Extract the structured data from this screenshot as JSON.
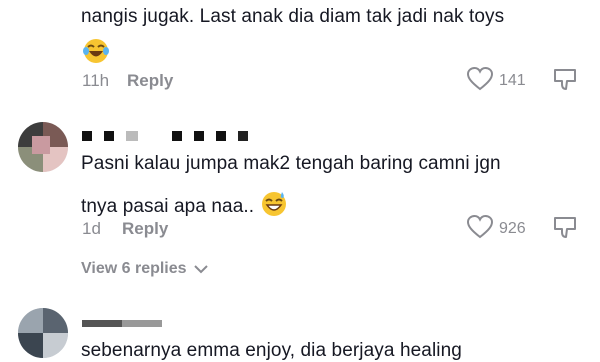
{
  "comment1": {
    "text": "nangis jugak. Last anak dia diam tak jadi nak toys",
    "time": "11h",
    "reply_label": "Reply",
    "likes": "141",
    "emoji": "laughing-tears"
  },
  "comment2": {
    "line1": "Pasni kalau jumpa mak2 tengah baring camni jgn",
    "line2": "tnya pasai apa naa..",
    "emoji": "sweat-smile",
    "time": "1d",
    "reply_label": "Reply",
    "likes": "926",
    "view_replies": "View 6 replies"
  },
  "comment3": {
    "text": "sebenarnya emma enjoy, dia berjaya healing"
  }
}
